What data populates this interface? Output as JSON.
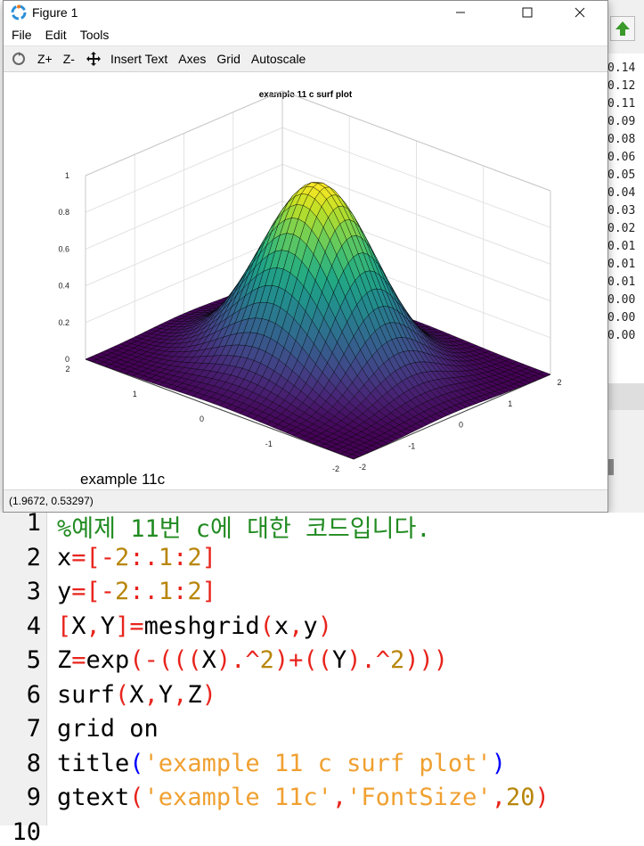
{
  "figure": {
    "title": "Figure 1",
    "menu": [
      "File",
      "Edit",
      "Tools"
    ],
    "toolbar": {
      "zoom_in": "Z+",
      "zoom_out": "Z-",
      "insert_text": "Insert Text",
      "axes": "Axes",
      "grid": "Grid",
      "autoscale": "Autoscale"
    },
    "status": "(1.9672, 0.53297)",
    "gtext_label": "example 11c"
  },
  "chart_data": {
    "type": "surface",
    "title": "example 11 c surf plot",
    "function": "Z=exp(-((X).^2+(Y).^2))",
    "x_range": [
      -2,
      2
    ],
    "y_range": [
      -2,
      2
    ],
    "x_step": 0.1,
    "z_range": [
      0,
      1
    ],
    "z_ticks": [
      "0",
      "0.2",
      "0.4",
      "0.6",
      "0.8",
      "1"
    ],
    "x_ticks": [
      "-2",
      "-1",
      "0",
      "1",
      "2"
    ],
    "y_ticks": [
      "-2",
      "-1",
      "0",
      "1",
      "2"
    ],
    "grid": true,
    "colormap": "viridis"
  },
  "background_values": [
    "0.14",
    "0.12",
    "0.11",
    "0.09",
    "0.08",
    "0.06",
    "0.05",
    "0.04",
    "0.03",
    "0.02",
    "0.01",
    "0.01",
    "0.01",
    "0.00",
    "0.00",
    "0.00"
  ],
  "code": {
    "line_numbers": [
      "1",
      "2",
      "3",
      "4",
      "5",
      "6",
      "7",
      "8",
      "9",
      "10"
    ],
    "lines": [
      [
        {
          "t": "%예제 11번 c에 대한 코드입니다.",
          "c": "cm"
        }
      ],
      [
        {
          "t": "x",
          "c": ""
        },
        {
          "t": "=[-",
          "c": "op"
        },
        {
          "t": "2",
          "c": "num"
        },
        {
          "t": ":.",
          "c": "op"
        },
        {
          "t": "1",
          "c": "num"
        },
        {
          "t": ":",
          "c": "op"
        },
        {
          "t": "2",
          "c": "num"
        },
        {
          "t": "]",
          "c": "op"
        }
      ],
      [
        {
          "t": "y",
          "c": ""
        },
        {
          "t": "=[-",
          "c": "op"
        },
        {
          "t": "2",
          "c": "num"
        },
        {
          "t": ":.",
          "c": "op"
        },
        {
          "t": "1",
          "c": "num"
        },
        {
          "t": ":",
          "c": "op"
        },
        {
          "t": "2",
          "c": "num"
        },
        {
          "t": "]",
          "c": "op"
        }
      ],
      [
        {
          "t": "[",
          "c": "op"
        },
        {
          "t": "X",
          "c": ""
        },
        {
          "t": ",",
          "c": "op"
        },
        {
          "t": "Y",
          "c": ""
        },
        {
          "t": "]=",
          "c": "op"
        },
        {
          "t": "meshgrid",
          "c": ""
        },
        {
          "t": "(",
          "c": "op"
        },
        {
          "t": "x",
          "c": ""
        },
        {
          "t": ",",
          "c": "op"
        },
        {
          "t": "y",
          "c": ""
        },
        {
          "t": ")",
          "c": "op"
        }
      ],
      [
        {
          "t": "Z",
          "c": ""
        },
        {
          "t": "=",
          "c": "op"
        },
        {
          "t": "exp",
          "c": ""
        },
        {
          "t": "(-(((",
          "c": "op"
        },
        {
          "t": "X",
          "c": ""
        },
        {
          "t": ").^",
          "c": "op"
        },
        {
          "t": "2",
          "c": "num"
        },
        {
          "t": ")+((",
          "c": "op"
        },
        {
          "t": "Y",
          "c": ""
        },
        {
          "t": ").^",
          "c": "op"
        },
        {
          "t": "2",
          "c": "num"
        },
        {
          "t": ")))",
          "c": "op"
        }
      ],
      [
        {
          "t": "surf",
          "c": ""
        },
        {
          "t": "(",
          "c": "op"
        },
        {
          "t": "X",
          "c": ""
        },
        {
          "t": ",",
          "c": "op"
        },
        {
          "t": "Y",
          "c": ""
        },
        {
          "t": ",",
          "c": "op"
        },
        {
          "t": "Z",
          "c": ""
        },
        {
          "t": ")",
          "c": "op"
        }
      ],
      [
        {
          "t": "grid on",
          "c": ""
        }
      ],
      [
        {
          "t": "title",
          "c": ""
        },
        {
          "t": "(",
          "c": "kw"
        },
        {
          "t": "'example 11 c surf plot'",
          "c": "str"
        },
        {
          "t": ")",
          "c": "kw"
        }
      ],
      [
        {
          "t": "gtext",
          "c": ""
        },
        {
          "t": "(",
          "c": "op"
        },
        {
          "t": "'example 11c'",
          "c": "str"
        },
        {
          "t": ",",
          "c": "op"
        },
        {
          "t": "'FontSize'",
          "c": "str"
        },
        {
          "t": ",",
          "c": "op"
        },
        {
          "t": "20",
          "c": "num"
        },
        {
          "t": ")",
          "c": "op"
        }
      ],
      []
    ]
  }
}
